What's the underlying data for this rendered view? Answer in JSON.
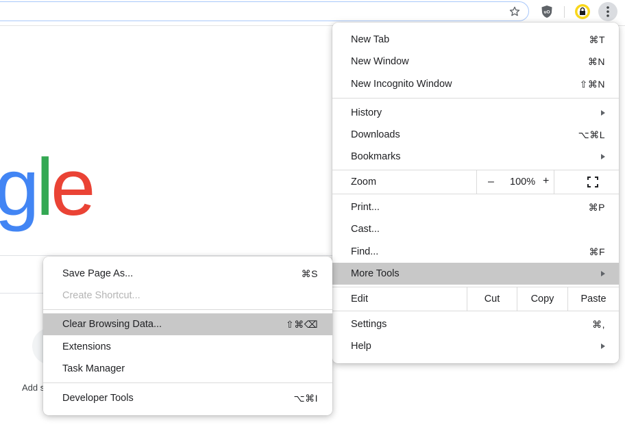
{
  "page": {
    "logo_letters": [
      {
        "char": "g",
        "color": "#4285f4"
      },
      {
        "char": "l",
        "color": "#34a853"
      },
      {
        "char": "e",
        "color": "#ea4335"
      }
    ],
    "add_shortcut_label": "Add s"
  },
  "main_menu": {
    "group1": [
      {
        "label": "New Tab",
        "shortcut": "⌘T"
      },
      {
        "label": "New Window",
        "shortcut": "⌘N"
      },
      {
        "label": "New Incognito Window",
        "shortcut": "⇧⌘N"
      }
    ],
    "group2": [
      {
        "label": "History",
        "shortcut": ""
      },
      {
        "label": "Downloads",
        "shortcut": "⌥⌘L"
      },
      {
        "label": "Bookmarks",
        "shortcut": ""
      }
    ],
    "zoom": {
      "label": "Zoom",
      "minus": "–",
      "value": "100%",
      "plus": "+"
    },
    "group3": [
      {
        "label": "Print...",
        "shortcut": "⌘P"
      },
      {
        "label": "Cast...",
        "shortcut": ""
      },
      {
        "label": "Find...",
        "shortcut": "⌘F"
      },
      {
        "label": "More Tools",
        "shortcut": ""
      }
    ],
    "edit": {
      "label": "Edit",
      "cut": "Cut",
      "copy": "Copy",
      "paste": "Paste"
    },
    "group4": [
      {
        "label": "Settings",
        "shortcut": "⌘,"
      },
      {
        "label": "Help",
        "shortcut": ""
      }
    ]
  },
  "more_tools_menu": {
    "group1": [
      {
        "label": "Save Page As...",
        "shortcut": "⌘S"
      },
      {
        "label": "Create Shortcut...",
        "shortcut": ""
      }
    ],
    "group2": [
      {
        "label": "Clear Browsing Data...",
        "shortcut": "⇧⌘⌫"
      },
      {
        "label": "Extensions",
        "shortcut": ""
      },
      {
        "label": "Task Manager",
        "shortcut": ""
      }
    ],
    "group3": [
      {
        "label": "Developer Tools",
        "shortcut": "⌥⌘I"
      }
    ]
  },
  "icons": {
    "star": "bookmark-star-icon",
    "extension": "ublock-shield-icon",
    "avatar": "profile-avatar-icon",
    "menu": "kebab-menu-icon",
    "fullscreen": "fullscreen-icon"
  },
  "colors": {
    "highlight": "#c8c8c8",
    "omnibox_border": "#a8c7fa",
    "avatar_yellow": "#f9d71c",
    "disabled_text": "#b4b4b4"
  }
}
